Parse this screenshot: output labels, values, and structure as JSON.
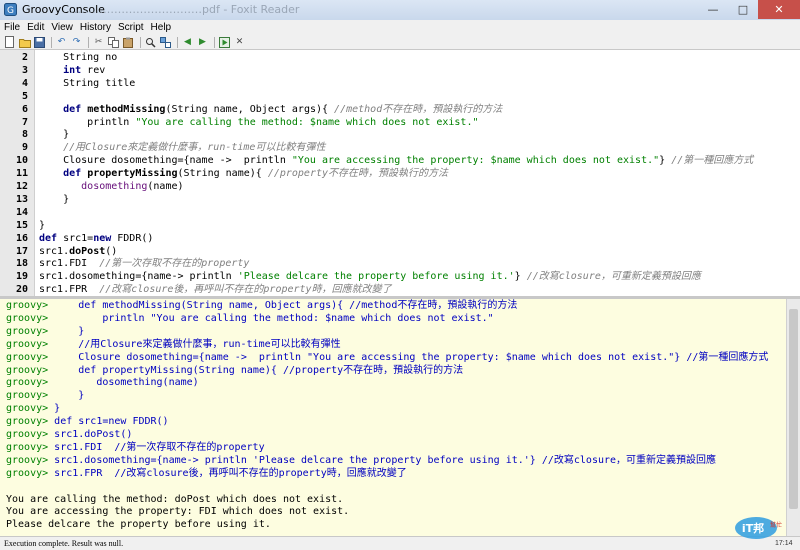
{
  "window": {
    "title": "GroovyConsole",
    "background_title_ghost": "………………………………pdf - Foxit Reader"
  },
  "menu": [
    "File",
    "Edit",
    "View",
    "History",
    "Script",
    "Help"
  ],
  "toolbar": {
    "icons": [
      "new-file-icon",
      "open-file-icon",
      "save-icon",
      "undo-icon",
      "redo-icon",
      "cut-icon",
      "copy-icon",
      "paste-icon",
      "find-icon",
      "replace-icon",
      "history-previous-icon",
      "history-next-icon",
      "run-script-icon",
      "interrupt-icon"
    ]
  },
  "editor": {
    "lines": [
      {
        "n": "2",
        "t": "    String no"
      },
      {
        "n": "3",
        "t": "    int rev"
      },
      {
        "n": "4",
        "t": "    String title"
      },
      {
        "n": "5",
        "t": ""
      },
      {
        "n": "6",
        "t": "    def methodMissing(String name, Object args){ //method不存在時，預設執行的方法"
      },
      {
        "n": "7",
        "t": "        println \"You are calling the method: $name which does not exist.\""
      },
      {
        "n": "8",
        "t": "    }"
      },
      {
        "n": "9",
        "t": "    //用Closure來定義做什麼事，run-time可以比較有彈性"
      },
      {
        "n": "10",
        "t": "    Closure dosomething={name ->  println \"You are accessing the property: $name which does not exist.\"} //第一種回應方式"
      },
      {
        "n": "11",
        "t": "    def propertyMissing(String name){ //property不存在時，預設執行的方法"
      },
      {
        "n": "12",
        "t": "       dosomething(name)"
      },
      {
        "n": "13",
        "t": "    }"
      },
      {
        "n": "14",
        "t": ""
      },
      {
        "n": "15",
        "t": "}"
      },
      {
        "n": "16",
        "t": "def src1=new FDDR()"
      },
      {
        "n": "17",
        "t": "src1.doPost()"
      },
      {
        "n": "18",
        "t": "src1.FDI  //第一次存取不存在的property"
      },
      {
        "n": "19",
        "t": "src1.dosomething={name-> println 'Please delcare the property before using it.'} //改寫closure，可重新定義預設回應"
      },
      {
        "n": "20",
        "t": "src1.FPR  //改寫closure後，再呼叫不存在的property時，回應就改變了"
      }
    ]
  },
  "output": {
    "prompt": "groovy>",
    "echo": [
      "     def methodMissing(String name, Object args){ //method不存在時，預設執行的方法",
      "         println \"You are calling the method: $name which does not exist.\"",
      "     }",
      "     //用Closure來定義做什麼事，run-time可以比較有彈性",
      "     Closure dosomething={name ->  println \"You are accessing the property: $name which does not exist.\"} //第一種回應方式",
      "     def propertyMissing(String name){ //property不存在時，預設執行的方法",
      "        dosomething(name)",
      "     }",
      " }",
      " def src1=new FDDR()",
      " src1.doPost()",
      " src1.FDI  //第一次存取不存在的property",
      " src1.dosomething={name-> println 'Please delcare the property before using it.'} //改寫closure，可重新定義預設回應",
      " src1.FPR  //改寫closure後，再呼叫不存在的property時，回應就改變了"
    ],
    "results": [
      "You are calling the method: doPost which does not exist.",
      "You are accessing the property: FDI which does not exist.",
      "Please delcare the property before using it."
    ]
  },
  "status": {
    "message": "Execution complete. Result was null.",
    "position": "17:14"
  },
  "watermark": {
    "logo_text": "iT邦",
    "sub_text": "幫忙"
  },
  "colors": {
    "keyword": "#000080",
    "string": "#008000",
    "comment": "#808080",
    "prompt": "#008000",
    "echo": "#0000c0",
    "output_background": "#fdfde0"
  }
}
